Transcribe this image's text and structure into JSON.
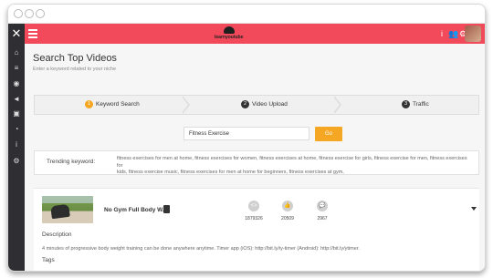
{
  "header": {
    "logo_text": "learnyoutube",
    "close_glyph": "✕",
    "menu_icon": "hamburger-icon",
    "info_glyph": "i",
    "users_glyph": "👥",
    "settings_glyph": "⚙",
    "accent_color": "#f24a5a"
  },
  "sidebar": {
    "items": [
      {
        "icon": "home-icon",
        "glyph": "⌂"
      },
      {
        "icon": "list-icon",
        "glyph": "≡"
      },
      {
        "icon": "gauge-icon",
        "glyph": "◉"
      },
      {
        "icon": "megaphone-icon",
        "glyph": "◄"
      },
      {
        "icon": "video-icon",
        "glyph": "▣"
      },
      {
        "icon": "pie-chart-icon",
        "glyph": "◔"
      },
      {
        "icon": "info-icon",
        "glyph": "i"
      },
      {
        "icon": "user-settings-icon",
        "glyph": "⚙"
      }
    ]
  },
  "page": {
    "title": "Search Top Videos",
    "subtitle": "Enter a keyword related to your niche"
  },
  "steps": [
    {
      "number": "1",
      "label": "Keyword Search",
      "color": "#f5a623"
    },
    {
      "number": "2",
      "label": "Video Upload",
      "color": "#333333"
    },
    {
      "number": "3",
      "label": "Traffic",
      "color": "#333333"
    }
  ],
  "search": {
    "value": "Fitness Exercise",
    "button_label": "Go"
  },
  "trending": {
    "label": "Trending keyword:",
    "line1": "fitness exercises for men at home, fitness exercises for women, fitness exercises at home, fitness exercise for girls, fitness exercise for men, fitness exercises for",
    "line2": "kids, fitness exercise music, fitness exercises for men at home for beginners, fitness exercises at gym,"
  },
  "video": {
    "title": "No Gym Full Body W...",
    "stats": [
      {
        "icon": "code-icon",
        "glyph": "<>",
        "value": "1879326"
      },
      {
        "icon": "thumbs-up-icon",
        "glyph": "👍",
        "value": "20509"
      },
      {
        "icon": "comment-icon",
        "glyph": "💬",
        "value": "2967"
      }
    ],
    "description_label": "Description",
    "description_text": "4 minutes of progressive body weight training can be done anywhere anytime. Timer app (iOS): http://bit.ly/iy-timer (Android): http://bit.ly/ytimer.",
    "tags_label": "Tags"
  }
}
